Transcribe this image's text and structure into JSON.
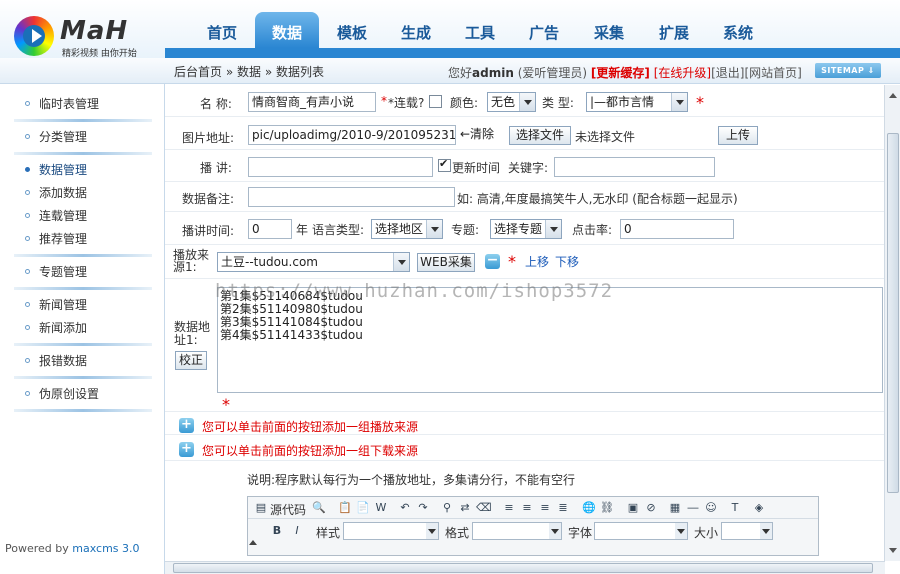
{
  "brand": {
    "name": "MaH",
    "slogan": "精彩视频 由你开始"
  },
  "nav": {
    "items": [
      "首页",
      "数据",
      "模板",
      "生成",
      "工具",
      "广告",
      "采集",
      "扩展",
      "系统"
    ],
    "active": "数据"
  },
  "breadcrumb": {
    "home": "后台首页",
    "sep": " » ",
    "section": "数据",
    "page": "数据列表"
  },
  "user": {
    "greeting_pre": "您好",
    "name": "admin",
    "role": "(爱听管理员)",
    "clear_cache": "[更新缓存]",
    "upgrade": "[在线升级]",
    "logout": "[退出]",
    "site_home": "[网站首页]",
    "sitemap": "SITEMAP"
  },
  "sidebar": {
    "items": [
      {
        "label": "临时表管理"
      },
      {
        "label": "分类管理"
      },
      {
        "label": "数据管理",
        "active": true
      },
      {
        "label": "添加数据"
      },
      {
        "label": "连载管理"
      },
      {
        "label": "推荐管理"
      },
      {
        "label": "专题管理"
      },
      {
        "label": "新闻管理"
      },
      {
        "label": "新闻添加"
      },
      {
        "label": "报错数据"
      },
      {
        "label": "伪原创设置"
      }
    ],
    "powered_pre": "Powered by ",
    "powered_name": "maxcms 3.0"
  },
  "form": {
    "name_label": "名  称:",
    "name_value": "情商智商_有声小说",
    "serial_label": "*连载?",
    "color_label": "颜色:",
    "color_value": "无色",
    "type_label": "类  型:",
    "type_value": "|—都市言情",
    "pic_label": "图片地址:",
    "pic_value": "pic/uploadimg/2010-9/201095231",
    "clear_btn": "←清除",
    "choose_file_btn": "选择文件",
    "no_file": "未选择文件",
    "upload_btn": "上传",
    "speaker_label": "播  讲:",
    "speaker_value": "",
    "update_time_label": "更新时间",
    "keyword_label": "关键字:",
    "keyword_value": "",
    "note_label": "数据备注:",
    "note_value": "",
    "note_hint": "如: 高清,年度最搞笑牛人,无水印 (配合标题一起显示)",
    "play_time_label": "播讲时间:",
    "play_time_value": "0",
    "year_label": "年",
    "lang_label": "语言类型:",
    "region_value": "选择地区",
    "topic_label": "专题:",
    "topic_value": "选择专题",
    "hits_label": "点击率:",
    "hits_value": "0",
    "source_label": "播放来\n源1:",
    "source_value": "土豆--tudou.com",
    "web_collect_btn": "WEB采集",
    "move_up": "上移",
    "move_down": "下移",
    "url_label": "数据地\n址1:",
    "proof_btn": "校正",
    "urls": "第1集$51140684$tudou\n第2集$51140980$tudou\n第3集$51141084$tudou\n第4集$51141433$tudou",
    "add_play_source": "您可以单击前面的按钮添加一组播放来源",
    "add_download_source": "您可以单击前面的按钮添加一组下载来源",
    "explain": "说明:程序默认每行为一个播放地址，多集请分行，不能有空行"
  },
  "editor": {
    "source_label": "源代码",
    "style_label": "样式",
    "format_label": "格式",
    "font_label": "字体",
    "size_label": "大小"
  },
  "watermark": "https://www.huzhan.com/ishop3572"
}
